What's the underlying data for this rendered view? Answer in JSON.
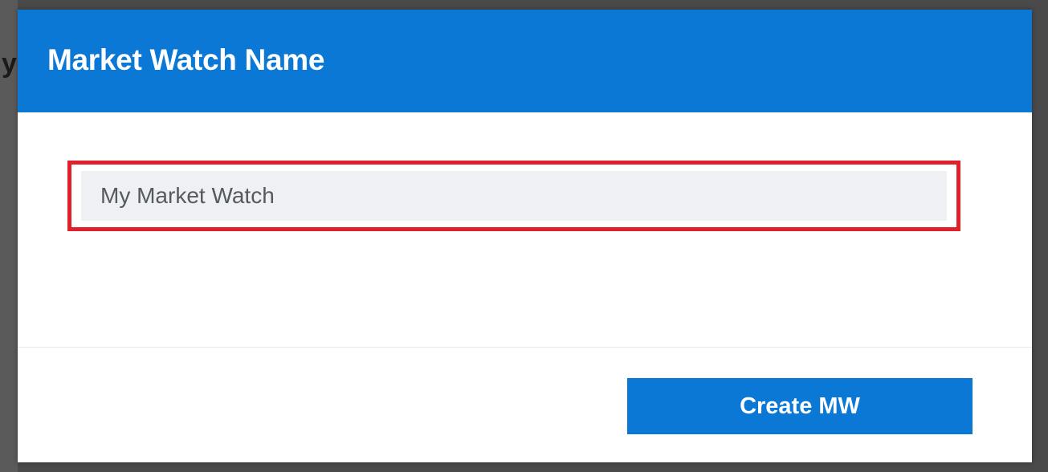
{
  "backdrop": {
    "partial_glyph": "y"
  },
  "modal": {
    "title": "Market Watch Name",
    "name_field": {
      "value": "My Market Watch",
      "placeholder": "My Market Watch",
      "highlight_color": "#e0202a"
    },
    "create_button_label": "Create MW"
  },
  "colors": {
    "accent": "#0a78d4",
    "field_background": "#eef0f4"
  }
}
